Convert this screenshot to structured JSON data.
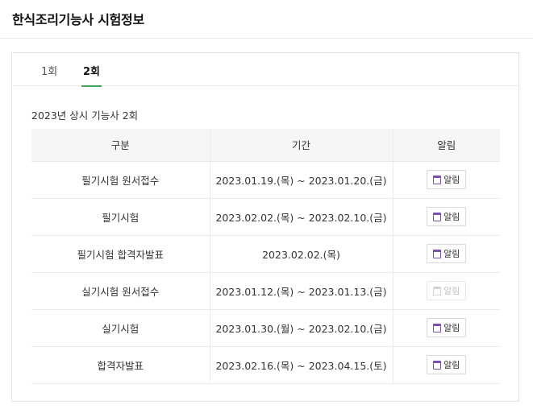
{
  "page": {
    "title": "한식조리기능사 시험정보"
  },
  "tabs": [
    {
      "label": "1회",
      "active": false
    },
    {
      "label": "2회",
      "active": true
    }
  ],
  "section": {
    "title": "2023년 상시 기능사 2회"
  },
  "table": {
    "headers": [
      "구분",
      "기간",
      "알림"
    ],
    "rows": [
      {
        "category": "필기시험 원서접수",
        "period": "2023.01.19.(목) ~ 2023.01.20.(금)",
        "alarm": "알림",
        "enabled": true
      },
      {
        "category": "필기시험",
        "period": "2023.02.02.(목) ~ 2023.02.10.(금)",
        "alarm": "알림",
        "enabled": true
      },
      {
        "category": "필기시험 합격자발표",
        "period": "2023.02.02.(목)",
        "alarm": "알림",
        "enabled": true
      },
      {
        "category": "실기시험 원서접수",
        "period": "2023.01.12.(목) ~ 2023.01.13.(금)",
        "alarm": "알림",
        "enabled": false
      },
      {
        "category": "실기시험",
        "period": "2023.01.30.(월) ~ 2023.02.10.(금)",
        "alarm": "알림",
        "enabled": true
      },
      {
        "category": "합격자발표",
        "period": "2023.02.16.(목) ~ 2023.04.15.(토)",
        "alarm": "알림",
        "enabled": true
      }
    ]
  },
  "icons": {
    "alarm": "calendar-icon"
  },
  "colors": {
    "accent": "#3aa55a",
    "icon": "#7a4fb0"
  }
}
